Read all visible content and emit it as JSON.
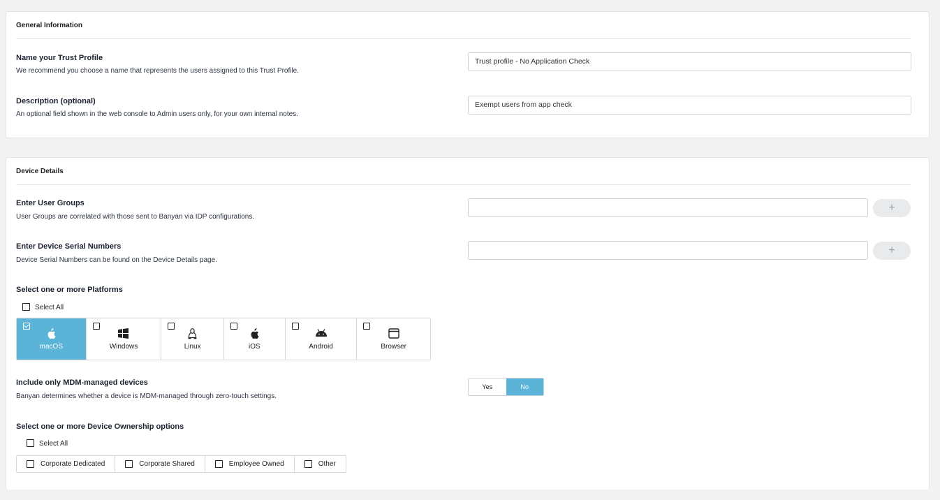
{
  "general": {
    "header": "General Information",
    "name_title": "Name your Trust Profile",
    "name_desc": "We recommend you choose a name that represents the users assigned to this Trust Profile.",
    "name_value": "Trust profile - No Application Check",
    "desc_title": "Description (optional)",
    "desc_desc": "An optional field shown in the web console to Admin users only, for your own internal notes.",
    "desc_value": "Exempt users from app check"
  },
  "device": {
    "header": "Device Details",
    "groups_title": "Enter User Groups",
    "groups_desc": "User Groups are correlated with those sent to Banyan via IDP configurations.",
    "groups_value": "",
    "serial_title": "Enter Device Serial Numbers",
    "serial_desc": "Device Serial Numbers can be found on the Device Details page.",
    "serial_value": "",
    "add_label": "+",
    "platforms_title": "Select one or more Platforms",
    "platforms_select_all": "Select All",
    "platforms": [
      {
        "label": "macOS",
        "icon": "apple-icon",
        "checked": true
      },
      {
        "label": "Windows",
        "icon": "windows-icon",
        "checked": false
      },
      {
        "label": "Linux",
        "icon": "linux-icon",
        "checked": false
      },
      {
        "label": "iOS",
        "icon": "apple-icon",
        "checked": false
      },
      {
        "label": "Android",
        "icon": "android-icon",
        "checked": false
      },
      {
        "label": "Browser",
        "icon": "browser-icon",
        "checked": false
      }
    ],
    "mdm_title": "Include only MDM-managed devices",
    "mdm_desc": "Banyan determines whether a device is MDM-managed through zero-touch settings.",
    "mdm_yes": "Yes",
    "mdm_no": "No",
    "mdm_selected": "No",
    "ownership_title": "Select one or more Device Ownership options",
    "ownership_select_all": "Select All",
    "ownership": [
      "Corporate Dedicated",
      "Corporate Shared",
      "Employee Owned",
      "Other"
    ]
  },
  "colors": {
    "accent": "#5bb4d8",
    "plus_button_bg": "#e9eaec"
  }
}
